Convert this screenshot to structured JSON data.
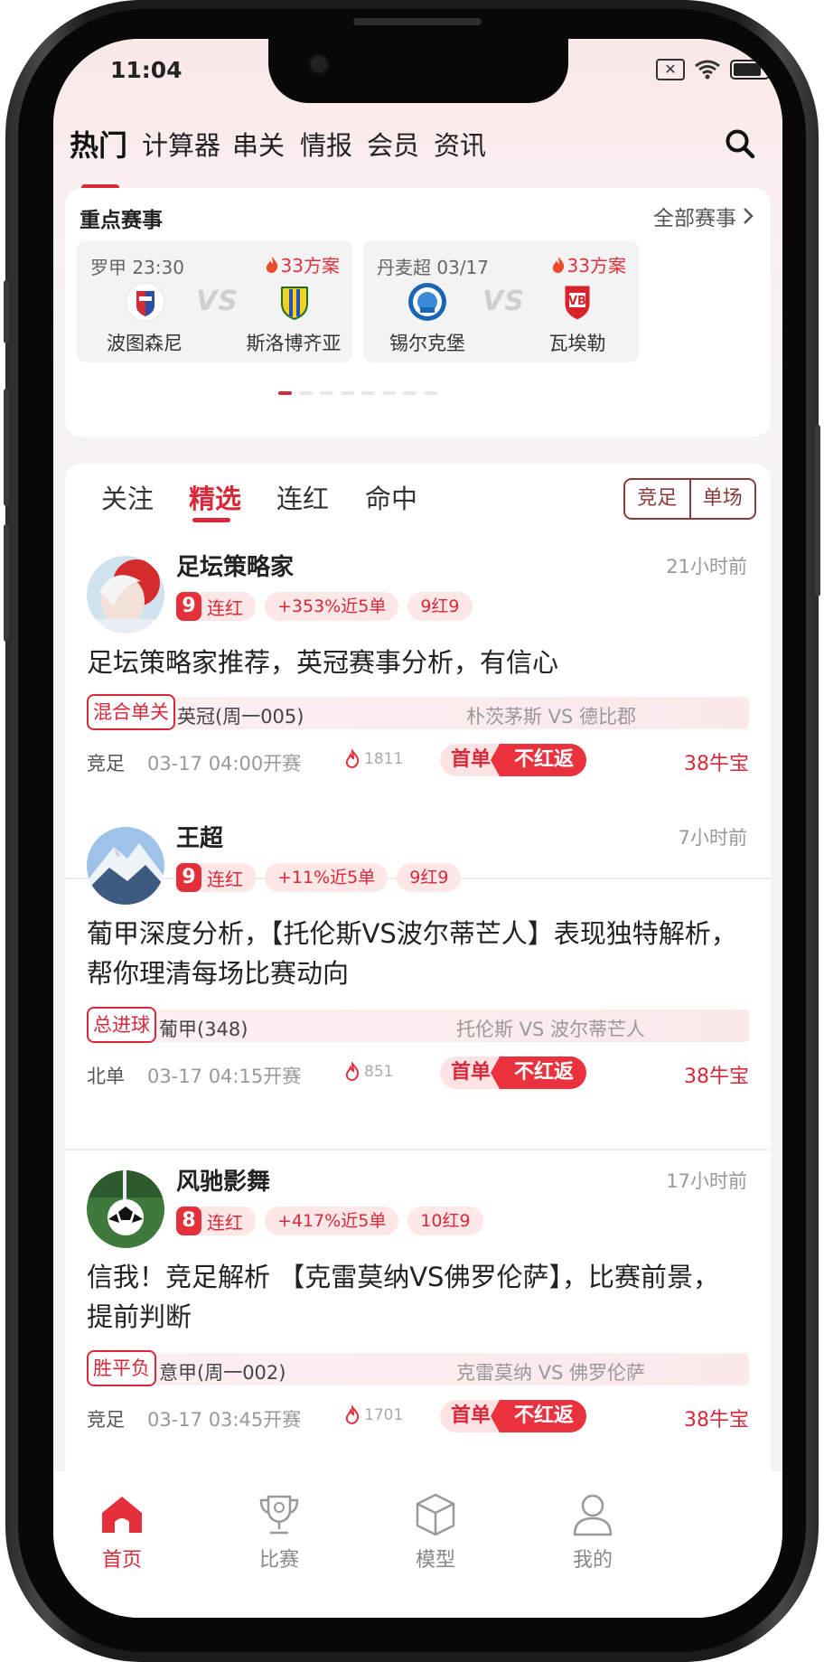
{
  "status_bar": {
    "time": "11:04"
  },
  "top_nav": {
    "tabs": [
      "热门",
      "计算器",
      "串关",
      "情报",
      "会员",
      "资讯"
    ],
    "active": "热门"
  },
  "key_matches": {
    "title": "重点赛事",
    "all_link": "全部赛事",
    "matches": [
      {
        "league": "罗甲 23:30",
        "hot": "33方案",
        "home": "波图森尼",
        "away": "斯洛博齐亚",
        "vs": "VS"
      },
      {
        "league": "丹麦超 03/17",
        "hot": "33方案",
        "home": "锡尔克堡",
        "away": "瓦埃勒",
        "vs": "VS"
      }
    ],
    "carousel_pages": 8,
    "carousel_active": 0
  },
  "feed": {
    "tabs": [
      "关注",
      "精选",
      "连红",
      "命中"
    ],
    "active_tab": "精选",
    "segment": [
      "竞足",
      "单场"
    ],
    "posts": [
      {
        "author": "足坛策略家",
        "time": "21小时前",
        "streak_num": "9",
        "streak_label": "连红",
        "roi": "+353%近5单",
        "record": "9红9",
        "title": "足坛策略家推荐，英冠赛事分析，有信心",
        "tag": "混合单关",
        "league": "英冠(周一005)",
        "teams": "朴茨茅斯 VS 德比郡",
        "type": "竞足",
        "start": "03-17 04:00开赛",
        "views": "1811",
        "first": "首单",
        "refund": "不红返",
        "price": "38牛宝"
      },
      {
        "author": "王超",
        "time": "7小时前",
        "streak_num": "9",
        "streak_label": "连红",
        "roi": "+11%近5单",
        "record": "9红9",
        "title": "葡甲深度分析，【托伦斯VS波尔蒂芒人】表现独特解析，帮你理清每场比赛动向",
        "tag": "总进球",
        "league": "葡甲(348)",
        "teams": "托伦斯 VS 波尔蒂芒人",
        "type": "北单",
        "start": "03-17 04:15开赛",
        "views": "851",
        "first": "首单",
        "refund": "不红返",
        "price": "38牛宝"
      },
      {
        "author": "风驰影舞",
        "time": "17小时前",
        "streak_num": "8",
        "streak_label": "连红",
        "roi": "+417%近5单",
        "record": "10红9",
        "title": "信我！竞足解析 【克雷莫纳VS佛罗伦萨】，比赛前景，提前判断",
        "tag": "胜平负",
        "league": "意甲(周一002)",
        "teams": "克雷莫纳 VS 佛罗伦萨",
        "type": "竞足",
        "start": "03-17 03:45开赛",
        "views": "1701",
        "first": "首单",
        "refund": "不红返",
        "price": "38牛宝"
      }
    ]
  },
  "tab_bar": {
    "items": [
      "首页",
      "比赛",
      "模型",
      "我的"
    ],
    "active": "首页"
  },
  "colors": {
    "accent": "#d9283a",
    "background": "#f6f3f3"
  }
}
